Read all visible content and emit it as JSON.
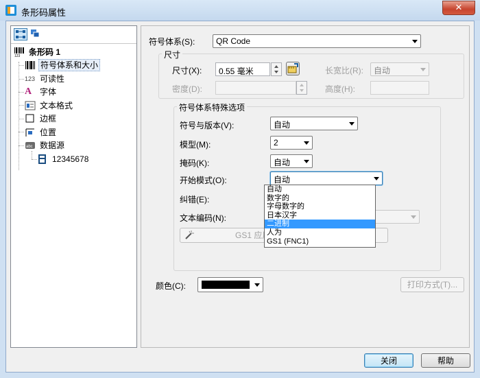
{
  "window": {
    "title": "条形码属性",
    "close_label": "✕"
  },
  "tree": {
    "root": "条形码 1",
    "items": [
      {
        "label": "符号体系和大小",
        "icon": "barcode-icon"
      },
      {
        "label": "可读性",
        "icon": "123-icon"
      },
      {
        "label": "字体",
        "icon": "font-icon"
      },
      {
        "label": "文本格式",
        "icon": "text-format-icon"
      },
      {
        "label": "边框",
        "icon": "border-icon"
      },
      {
        "label": "位置",
        "icon": "position-icon"
      },
      {
        "label": "数据源",
        "icon": "datasource-icon"
      }
    ],
    "datasource_child": "12345678",
    "datasource_icon_text": "abc",
    "num_icon_text": "123",
    "root_icon_text": "123"
  },
  "symbology": {
    "label": "符号体系(S):",
    "value": "QR Code"
  },
  "size_group": {
    "title": "尺寸",
    "size_label": "尺寸(X):",
    "size_value": "0.55 毫米",
    "aspect_label": "长宽比(R):",
    "aspect_value": "自动",
    "density_label": "密度(D):",
    "height_label": "高度(H):"
  },
  "special_group": {
    "title": "符号体系特殊选项",
    "version_label": "符号与版本(V):",
    "version_value": "自动",
    "model_label": "模型(M):",
    "model_value": "2",
    "mask_label": "掩码(K):",
    "mask_value": "自动",
    "start_mode_label": "开始模式(O):",
    "start_mode_value": "自动",
    "error_label": "纠错(E):",
    "encoding_label": "文本编码(N):",
    "gs1_button": "GS1 应用标"
  },
  "start_mode_options": [
    "自动",
    "数字的",
    "字母数字的",
    "日本汉字",
    "二进制",
    "人为",
    "GS1 (FNC1)"
  ],
  "start_mode_highlighted": "二进制",
  "color": {
    "label": "颜色(C):",
    "swatch": "#000000"
  },
  "print_method_button": "打印方式(T)...",
  "footer": {
    "close_button": "关闭",
    "help_button": "帮助"
  }
}
